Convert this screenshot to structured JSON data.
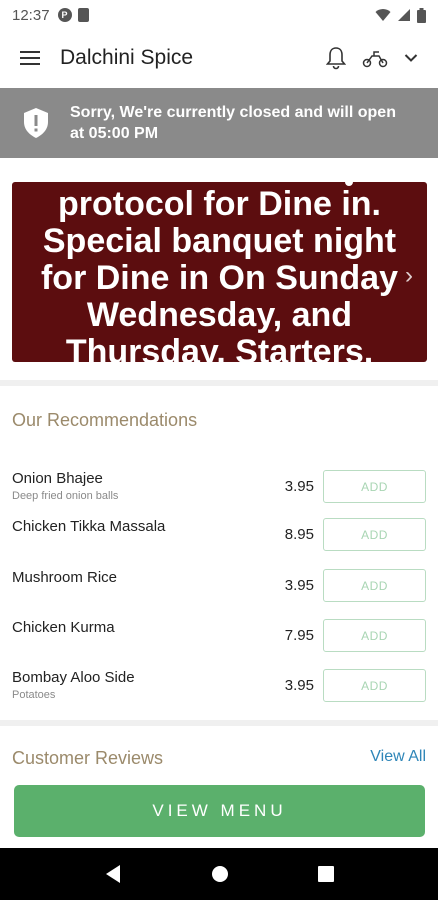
{
  "status_bar": {
    "time": "12:37"
  },
  "app_bar": {
    "title": "Dalchini Spice"
  },
  "closed_banner": {
    "message_line1": "Sorry, We're currently closed and will open",
    "message_line2": "at 05:00 PM"
  },
  "promo": {
    "text": "protocol for Dine in. Special banquet night for Dine in On Sunday Wednesday, and Thursday. Starters,"
  },
  "recommendations": {
    "title": "Our Recommendations",
    "items": [
      {
        "name": "Onion Bhajee",
        "desc": "Deep fried onion balls",
        "price": "3.95",
        "add": "ADD"
      },
      {
        "name": "Chicken Tikka Massala",
        "desc": "",
        "price": "8.95",
        "add": "ADD"
      },
      {
        "name": "Mushroom Rice",
        "desc": "",
        "price": "3.95",
        "add": "ADD"
      },
      {
        "name": "Chicken Kurma",
        "desc": "",
        "price": "7.95",
        "add": "ADD"
      },
      {
        "name": "Bombay Aloo Side",
        "desc": "Potatoes",
        "price": "3.95",
        "add": "ADD"
      }
    ]
  },
  "reviews": {
    "title": "Customer Reviews",
    "view_all": "View All"
  },
  "cta": {
    "view_menu": "VIEW MENU"
  },
  "colors": {
    "banner": "#8a8a8a",
    "promo_bg": "#5c0d0f",
    "accent_green": "#5bb06c",
    "link_blue": "#2f86b8",
    "section_title": "#9b8a6b"
  }
}
